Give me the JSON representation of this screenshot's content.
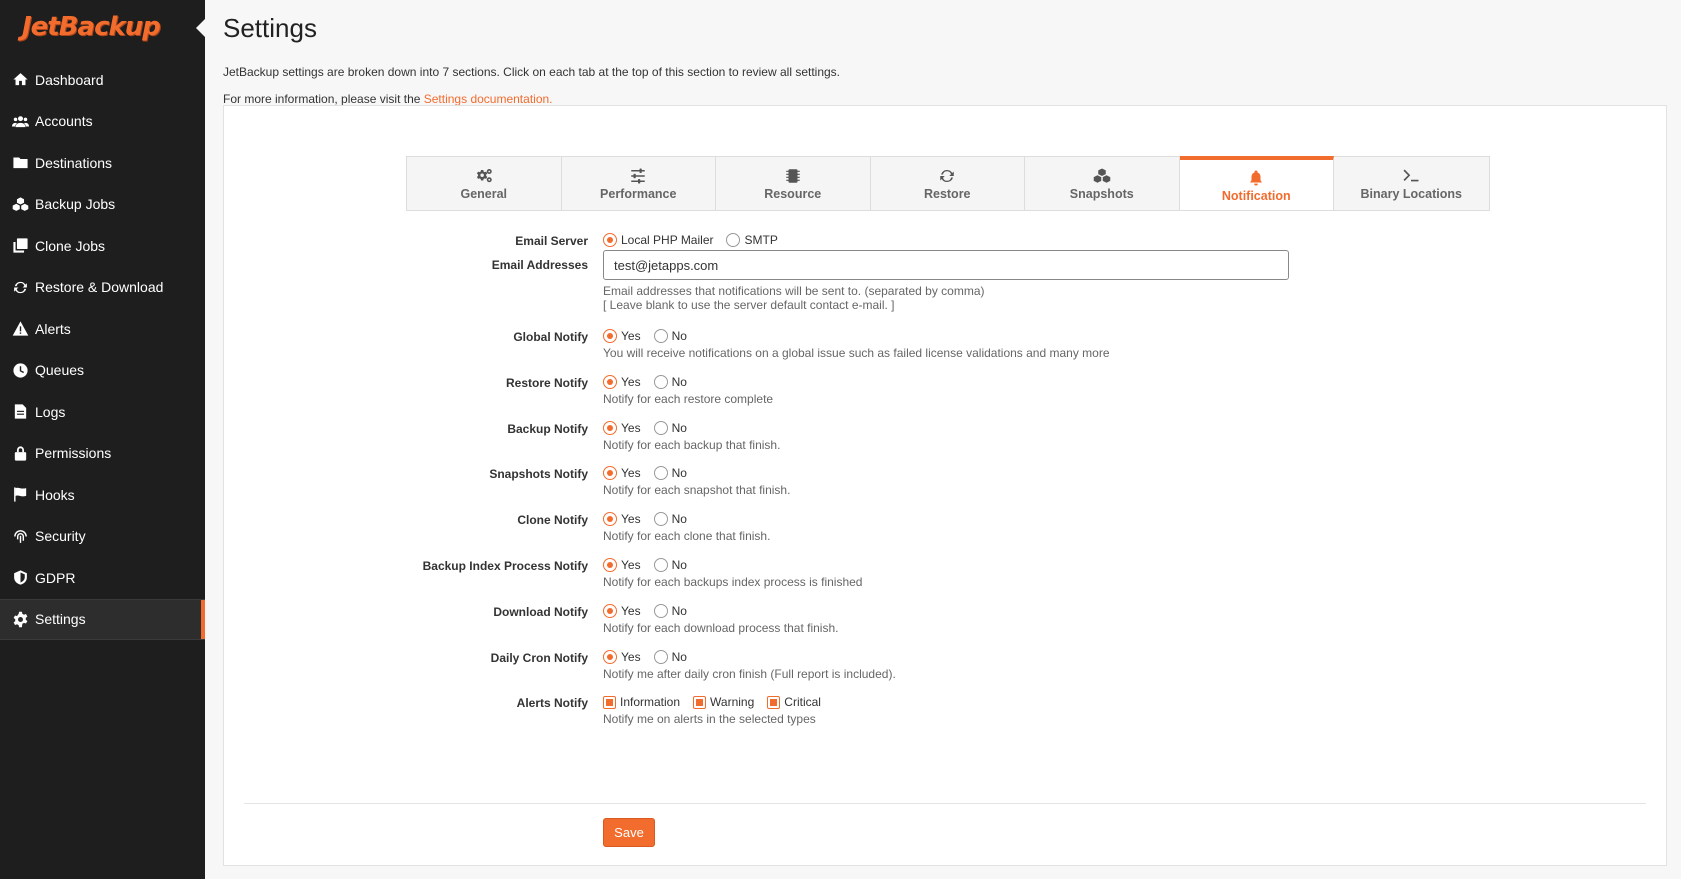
{
  "brand": {
    "logo": "JetBackup",
    "accent": "#f26c2e"
  },
  "sidebar": {
    "items": [
      {
        "label": "Dashboard",
        "icon": "home-icon"
      },
      {
        "label": "Accounts",
        "icon": "users-icon"
      },
      {
        "label": "Destinations",
        "icon": "folder-icon"
      },
      {
        "label": "Backup Jobs",
        "icon": "cubes-icon"
      },
      {
        "label": "Clone Jobs",
        "icon": "clone-icon"
      },
      {
        "label": "Restore & Download",
        "icon": "sync-icon"
      },
      {
        "label": "Alerts",
        "icon": "warning-icon"
      },
      {
        "label": "Queues",
        "icon": "clock-icon"
      },
      {
        "label": "Logs",
        "icon": "file-icon"
      },
      {
        "label": "Permissions",
        "icon": "lock-icon"
      },
      {
        "label": "Hooks",
        "icon": "flag-icon"
      },
      {
        "label": "Security",
        "icon": "fingerprint-icon"
      },
      {
        "label": "GDPR",
        "icon": "shield-icon"
      },
      {
        "label": "Settings",
        "icon": "gear-icon",
        "active": true
      }
    ]
  },
  "header": {
    "title": "Settings",
    "intro": "JetBackup settings are broken down into 7 sections. Click on each tab at the top of this section to review all settings.",
    "more_info_prefix": "For more information, please visit the ",
    "more_info_link": "Settings documentation."
  },
  "tabs": [
    {
      "label": "General",
      "icon": "cogs-icon"
    },
    {
      "label": "Performance",
      "icon": "sliders-icon"
    },
    {
      "label": "Resource",
      "icon": "chip-icon"
    },
    {
      "label": "Restore",
      "icon": "sync-icon"
    },
    {
      "label": "Snapshots",
      "icon": "cubes-icon"
    },
    {
      "label": "Notification",
      "icon": "bell-icon",
      "active": true
    },
    {
      "label": "Binary Locations",
      "icon": "terminal-icon"
    }
  ],
  "form": {
    "email_server": {
      "label": "Email Server",
      "options": [
        "Local PHP Mailer",
        "SMTP"
      ],
      "selected": "Local PHP Mailer"
    },
    "email_addresses": {
      "label": "Email Addresses",
      "value": "test@jetapps.com",
      "help1": "Email addresses that notifications will be sent to. (separated by comma)",
      "help2": "[ Leave blank to use the server default contact e-mail. ]"
    },
    "yes_label": "Yes",
    "no_label": "No",
    "notify_rows": [
      {
        "label": "Global Notify",
        "selected": "Yes",
        "help": "You will receive notifications on a global issue such as failed license validations and many more"
      },
      {
        "label": "Restore Notify",
        "selected": "Yes",
        "help": "Notify for each restore complete"
      },
      {
        "label": "Backup Notify",
        "selected": "Yes",
        "help": "Notify for each backup that finish."
      },
      {
        "label": "Snapshots Notify",
        "selected": "Yes",
        "help": "Notify for each snapshot that finish."
      },
      {
        "label": "Clone Notify",
        "selected": "Yes",
        "help": "Notify for each clone that finish."
      },
      {
        "label": "Backup Index Process Notify",
        "selected": "Yes",
        "help": "Notify for each backups index process is finished"
      },
      {
        "label": "Download Notify",
        "selected": "Yes",
        "help": "Notify for each download process that finish."
      },
      {
        "label": "Daily Cron Notify",
        "selected": "Yes",
        "help": "Notify me after daily cron finish (Full report is included)."
      }
    ],
    "alerts_notify": {
      "label": "Alerts Notify",
      "options": [
        {
          "label": "Information",
          "checked": true
        },
        {
          "label": "Warning",
          "checked": true
        },
        {
          "label": "Critical",
          "checked": true
        }
      ],
      "help": "Notify me on alerts in the selected types"
    },
    "save_label": "Save"
  }
}
